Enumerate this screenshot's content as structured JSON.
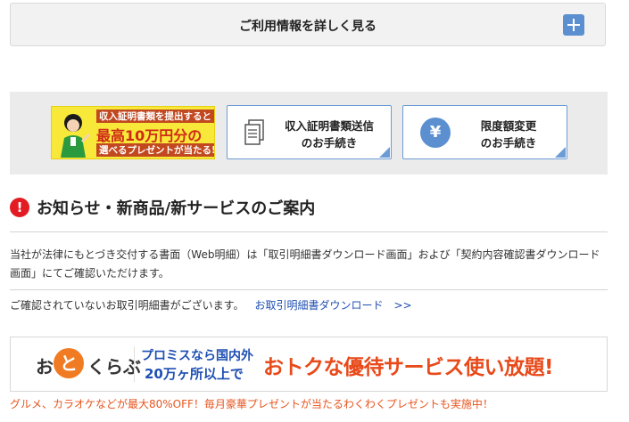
{
  "accordion": {
    "label": "ご利用情報を詳しく見る",
    "toggle_icon": "plus-icon"
  },
  "promo_banner": {
    "line1": "収入証明書類を提出すると",
    "line2": "最高10万円分の",
    "line3": "選べるプレゼントが当たる!"
  },
  "buttons": [
    {
      "icon": "document-icon",
      "line1": "収入証明書類送信",
      "line2": "のお手続き"
    },
    {
      "icon": "yen-icon",
      "symbol": "¥",
      "line1": "限度額変更",
      "line2": "のお手続き"
    }
  ],
  "notice": {
    "alert_symbol": "!",
    "title": "お知らせ・新商品/新サービスのご案内",
    "body": "当社が法律にもとづき交付する書面（Web明細）は「取引明細書ダウンロード画面」および「契約内容確認書ダウンロード画面」にてご確認いただけます。",
    "confirm_text": "ご確認されていないお取引明細書がございます。",
    "confirm_link": "お取引明細書ダウンロード　>>"
  },
  "otoku_banner": {
    "logo_o": "お",
    "logo_circle": "と",
    "logo_rest": "くらぶ",
    "line1": "プロミスなら国内外",
    "line2": "20万ヶ所以上で",
    "headline": "おトクな優待サービス使い放題!"
  },
  "promo_text": "グルメ、カラオケなどが最大80%OFF！毎月豪華プレゼントが当たるわくわくプレゼントも実施中！",
  "colors": {
    "accent_blue": "#5b8fcf",
    "link_blue": "#1f4fb3",
    "alert_red": "#e31c23",
    "orange": "#e8541e"
  }
}
